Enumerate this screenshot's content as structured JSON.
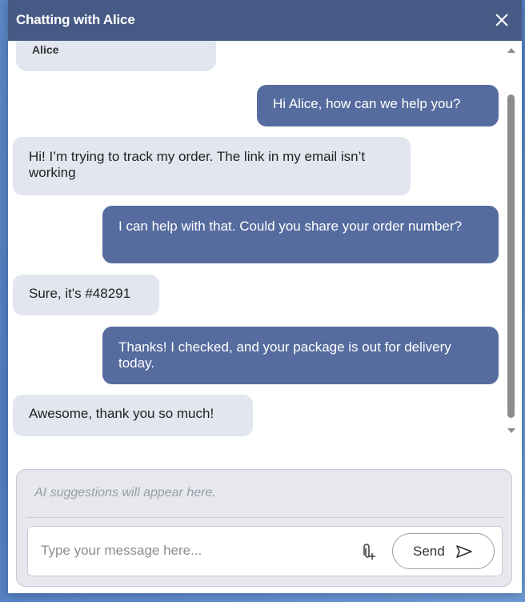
{
  "window": {
    "title": "Chatting with Alice"
  },
  "chat": {
    "sender_name": "Alice",
    "messages": [
      {
        "from": "agent",
        "text": "Hi Alice, how can we help you?"
      },
      {
        "from": "user",
        "text": "Hi! I’m trying to track my order. The link in my email isn’t working"
      },
      {
        "from": "agent",
        "text": "I can help with that. Could you share your order number?"
      },
      {
        "from": "user",
        "text": "Sure, it's #48291"
      },
      {
        "from": "agent",
        "text": "Thanks! I checked, and your package is out for delivery today."
      },
      {
        "from": "user",
        "text": "Awesome, thank you so much!"
      }
    ]
  },
  "composer": {
    "suggestions_text": "AI suggestions will appear here.",
    "input_placeholder": "Type your message here...",
    "input_value": "",
    "send_label": "Send"
  },
  "icons": {
    "close": "close-icon",
    "attach": "attach-icon",
    "send": "send-icon"
  },
  "colors": {
    "header": "#475a85",
    "outgoing_bubble": "#566c9f",
    "incoming_bubble": "#e2e6ee"
  }
}
